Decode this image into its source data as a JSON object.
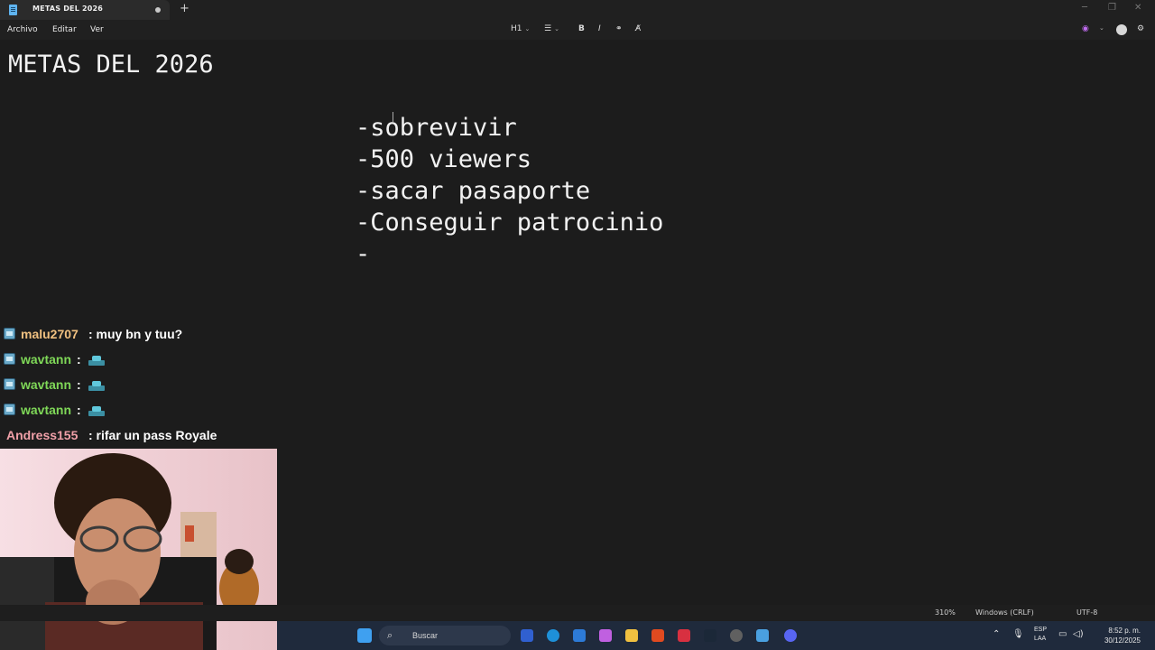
{
  "window": {
    "tab_title": "METAS DEL 2026",
    "new_tab": "+",
    "controls": [
      "─",
      "❐",
      "✕"
    ]
  },
  "menu": {
    "items": [
      "Archivo",
      "Editar",
      "Ver"
    ]
  },
  "toolbar": {
    "heading": "H1",
    "list_icon": "list-icon",
    "bold": "B",
    "italic": "I",
    "link_icon": "link-icon",
    "clear_format_icon": "clear-format-icon"
  },
  "document": {
    "title": "METAS DEL 2026",
    "goals": [
      "-sobrevivir",
      "-500 viewers",
      "-sacar pasaporte",
      "-Conseguir patrocinio",
      "-"
    ]
  },
  "status_bar": {
    "zoom": "310%",
    "line_ending": "Windows (CRLF)",
    "encoding": "UTF-8"
  },
  "chat": {
    "messages": [
      {
        "user": "malu2707",
        "text": ": muy bn y tuu?",
        "color": "#f0c080",
        "emote": false
      },
      {
        "user": "wavtann",
        "text": ":",
        "color": "#7fd858",
        "emote": true
      },
      {
        "user": "wavtann",
        "text": ":",
        "color": "#7fd858",
        "emote": true
      },
      {
        "user": "wavtann",
        "text": ":",
        "color": "#7fd858",
        "emote": true
      },
      {
        "user": "Andress155",
        "text": ": rifar un pass Royale",
        "color": "#f0a0a8",
        "emote": false
      }
    ]
  },
  "taskbar": {
    "search_placeholder": "Buscar",
    "language": "ESP",
    "keyboard": "LAA",
    "time": "8:52 p. m.",
    "date": "30/12/2025"
  }
}
